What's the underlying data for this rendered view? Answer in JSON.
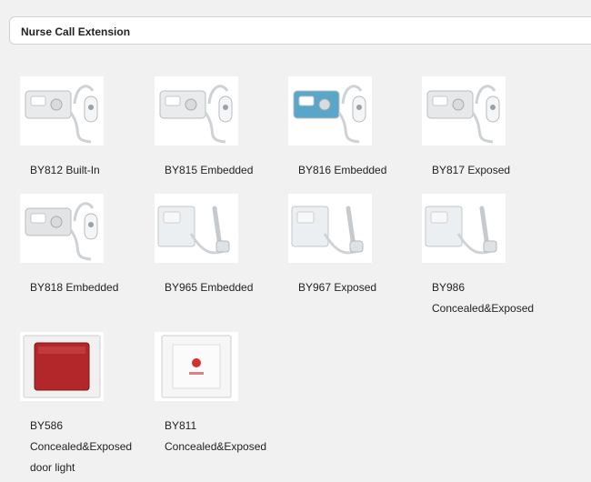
{
  "header": {
    "title": "Nurse Call Extension"
  },
  "products": [
    {
      "lines": [
        "BY812 Built-In"
      ],
      "icon": "handset-panel-icon"
    },
    {
      "lines": [
        "BY815 Embedded"
      ],
      "icon": "handset-panel-icon"
    },
    {
      "lines": [
        "BY816 Embedded"
      ],
      "icon": "handset-panel-icon"
    },
    {
      "lines": [
        "BY817 Exposed"
      ],
      "icon": "handset-panel-icon"
    },
    {
      "lines": [
        "BY818 Embedded"
      ],
      "icon": "handset-panel-icon"
    },
    {
      "lines": [
        "BY965 Embedded"
      ],
      "icon": "handset-wall-icon"
    },
    {
      "lines": [
        "BY967 Exposed"
      ],
      "icon": "handset-wall-icon"
    },
    {
      "lines": [
        "BY986",
        "Concealed&Exposed"
      ],
      "icon": "handset-wall-icon"
    },
    {
      "lines": [
        "BY586",
        "Concealed&Exposed",
        "door light"
      ],
      "icon": "door-light-icon"
    },
    {
      "lines": [
        "BY811",
        "Concealed&Exposed"
      ],
      "icon": "call-button-icon"
    }
  ]
}
